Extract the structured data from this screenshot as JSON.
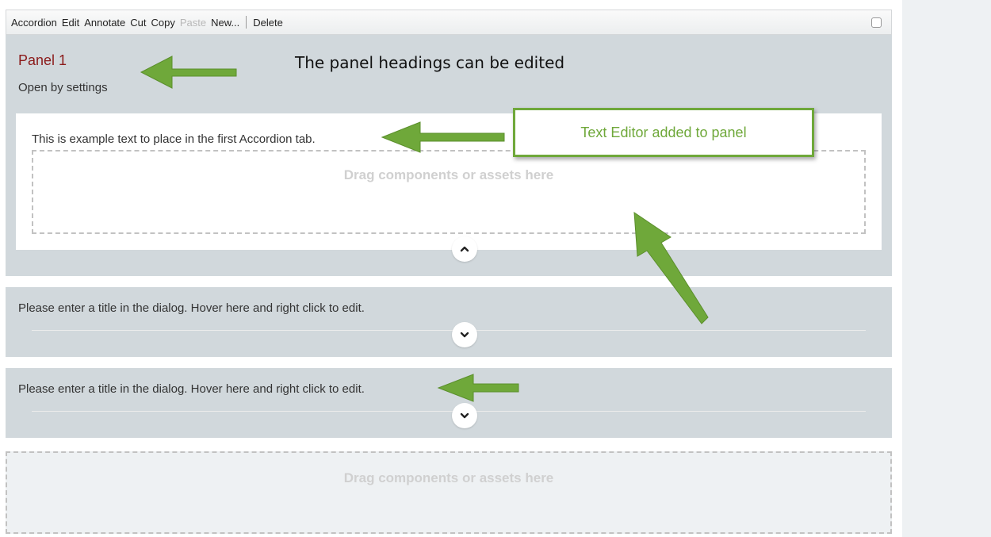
{
  "toolbar": {
    "items": [
      "Accordion",
      "Edit",
      "Annotate",
      "Cut",
      "Copy",
      "Paste",
      "New...",
      "Delete"
    ],
    "disabled": [
      "Paste"
    ]
  },
  "panel1": {
    "title": "Panel 1",
    "subtitle": "Open by settings",
    "content_text": "This is example text to place in the first Accordion tab.",
    "dropzone_label": "Drag components or assets here",
    "toggle_icon": "chevron-up-icon"
  },
  "panel2": {
    "title": "Please enter a title in the dialog. Hover here and right click to edit.",
    "toggle_icon": "chevron-down-icon"
  },
  "panel3": {
    "title": "Please enter a title in the dialog. Hover here and right click to edit.",
    "toggle_icon": "chevron-down-icon"
  },
  "bottom_dropzone": {
    "label": "Drag components or assets here"
  },
  "annotations": {
    "heading_note": "The panel headings can be edited",
    "callout": "Text Editor added to panel",
    "arrow_color": "#6fa83a"
  },
  "colors": {
    "panel_bg": "#d1d8dc",
    "panel_title": "#8b1a1a",
    "callout_border": "#6fa83a"
  }
}
